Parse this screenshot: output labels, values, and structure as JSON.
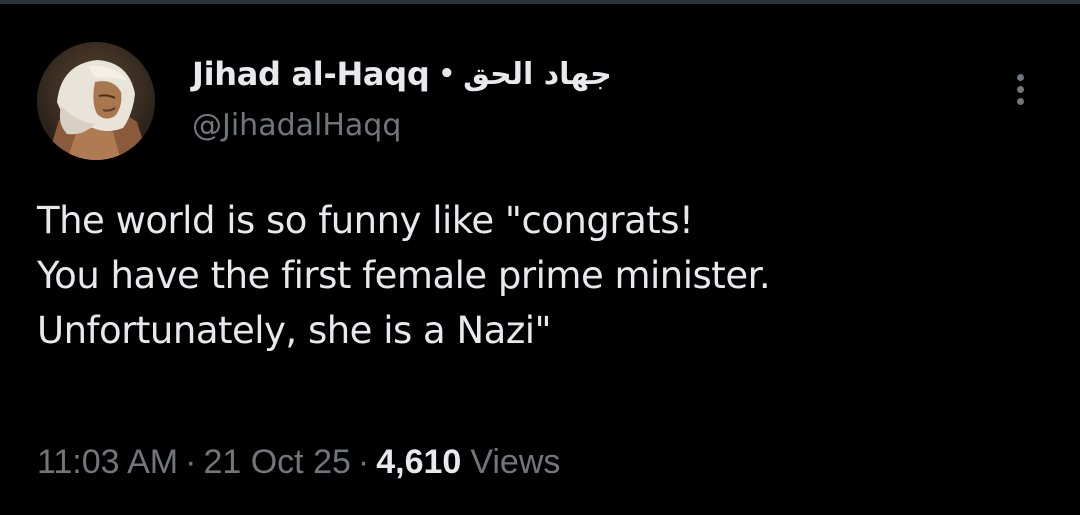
{
  "tweet": {
    "author": {
      "display_name": "Jihad al-Haqq",
      "separator": "•",
      "arabic_name": "جهاد الحق",
      "handle": "@JihadalHaqq"
    },
    "text_lines": [
      "The world is so funny like \"congrats!",
      "You have the first female prime minister.",
      "Unfortunately, she is a Nazi\""
    ],
    "meta": {
      "time": "11:03 AM",
      "separator": "·",
      "date": "21 Oct 25",
      "views_count": "4,610",
      "views_label": "Views"
    }
  },
  "colors": {
    "background": "#000000",
    "text_primary": "#e7e9ea",
    "text_secondary": "#71767b",
    "border": "#2f3336"
  },
  "icons": {
    "more": "more-vertical-icon"
  }
}
